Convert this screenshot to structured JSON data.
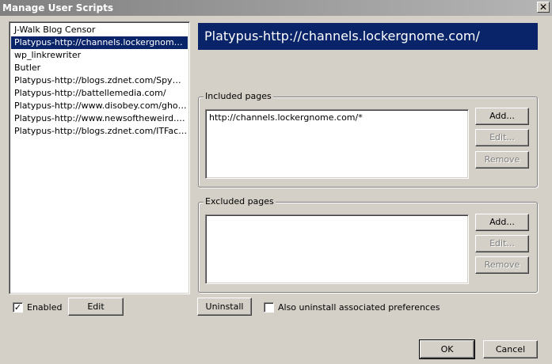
{
  "window": {
    "title": "Manage User Scripts",
    "close_glyph": "✕"
  },
  "scripts": [
    {
      "name": "J-Walk Blog Censor",
      "selected": false
    },
    {
      "name": "Platypus-http://channels.lockergnome.com/",
      "selected": true
    },
    {
      "name": "wp_linkrewriter",
      "selected": false
    },
    {
      "name": "Butler",
      "selected": false
    },
    {
      "name": "Platypus-http://blogs.zdnet.com/Spyware/...",
      "selected": false
    },
    {
      "name": "Platypus-http://battellemedia.com/",
      "selected": false
    },
    {
      "name": "Platypus-http://www.disobey.com/ghostsi...",
      "selected": false
    },
    {
      "name": "Platypus-http://www.newsoftheweird.com/ar...",
      "selected": false
    },
    {
      "name": "Platypus-http://blogs.zdnet.com/ITFacts/i...",
      "selected": false
    }
  ],
  "enabled": {
    "label": "Enabled",
    "checked": true,
    "check_glyph": "✓"
  },
  "edit_button": "Edit",
  "selected_script_title": "Platypus-http://channels.lockergnome.com/",
  "included": {
    "legend": "Included pages",
    "entries": [
      "http://channels.lockergnome.com/*"
    ],
    "add": "Add...",
    "edit": "Edit...",
    "remove": "Remove"
  },
  "excluded": {
    "legend": "Excluded pages",
    "entries": [],
    "add": "Add...",
    "edit": "Edit...",
    "remove": "Remove"
  },
  "uninstall_button": "Uninstall",
  "uninstall_prefs": {
    "label": "Also uninstall associated preferences",
    "checked": false
  },
  "ok_button": "OK",
  "cancel_button": "Cancel",
  "colors": {
    "face": "#d4d0c8",
    "selection": "#0a246a",
    "titlebar": "#808080"
  }
}
